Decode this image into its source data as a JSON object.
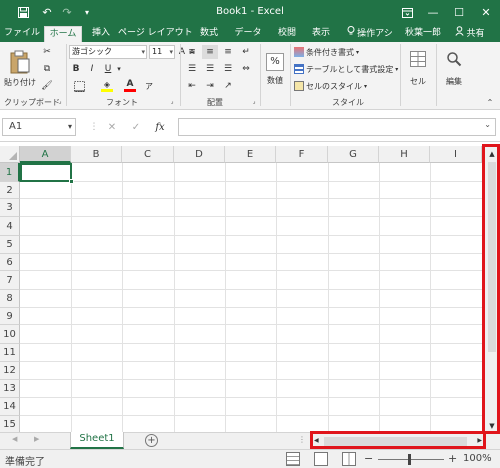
{
  "title_bar": {
    "title": "Book1 - Excel",
    "save_icon": "save-icon",
    "undo_icon": "undo-icon",
    "redo_icon": "redo-icon",
    "customize_icon": "customize-quick-access-icon",
    "ribbon_display_icon": "ribbon-display-icon",
    "minimize": "—",
    "restore": "☐",
    "close": "✕"
  },
  "tabs": {
    "file": "ファイル",
    "home": "ホーム",
    "insert": "挿入",
    "layout": "ページ レイアウト",
    "formulas": "数式",
    "data": "データ",
    "review": "校閲",
    "view": "表示",
    "tell_me": "操作アシ",
    "user": "秋葉一郎",
    "share": "共有"
  },
  "ribbon": {
    "paste": "貼り付け",
    "clipboard_label": "クリップボード",
    "font_name": "游ゴシック",
    "font_size": "11",
    "bold": "B",
    "italic": "I",
    "underline": "U",
    "font_label": "フォント",
    "alignment_label": "配置",
    "number_symbol": "%",
    "number_label": "数値",
    "cond_format": "条件付き書式",
    "format_table": "テーブルとして書式設定",
    "cell_styles": "セルのスタイル",
    "styles_label": "スタイル",
    "cells": "セル",
    "editing": "編集"
  },
  "formula_bar": {
    "name_box": "A1",
    "cancel": "✕",
    "enter": "✓",
    "fx": "fx",
    "formula": ""
  },
  "grid": {
    "columns": [
      "A",
      "B",
      "C",
      "D",
      "E",
      "F",
      "G",
      "H",
      "I"
    ],
    "rows": [
      "1",
      "2",
      "3",
      "4",
      "5",
      "6",
      "7",
      "8",
      "9",
      "10",
      "11",
      "12",
      "13",
      "14",
      "15"
    ],
    "selected_cell": "A1"
  },
  "sheet_tabs": {
    "active": "Sheet1",
    "add": "+"
  },
  "status_bar": {
    "status": "準備完了",
    "zoom": "100%",
    "zoom_out": "−",
    "zoom_in": "+"
  },
  "colors": {
    "excel_green": "#217346",
    "highlight_red": "#e0151b"
  }
}
